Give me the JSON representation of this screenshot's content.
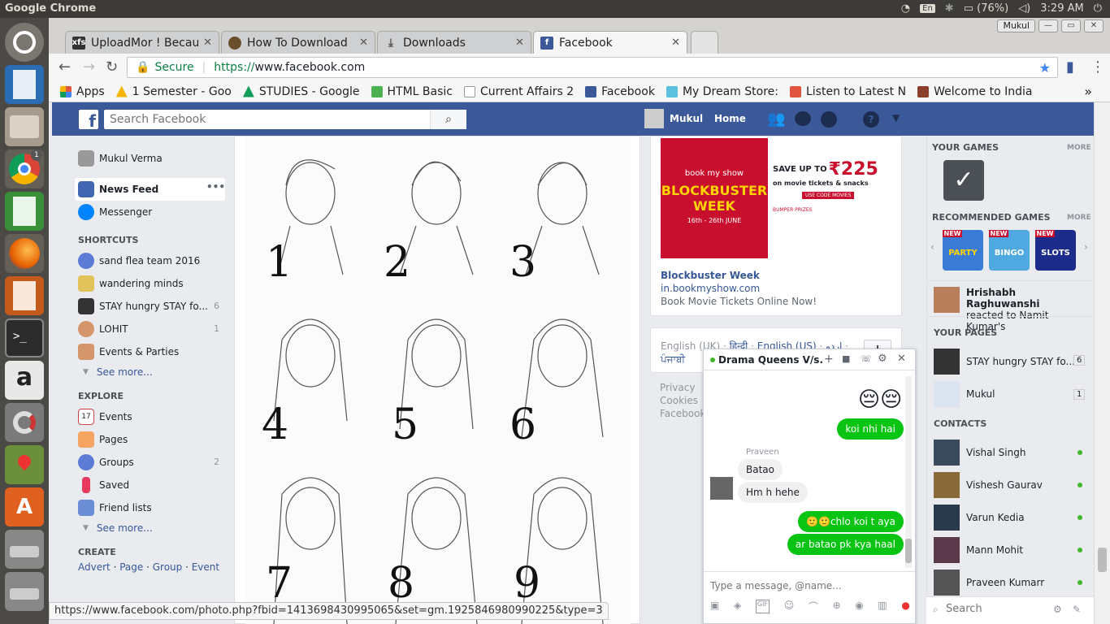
{
  "os": {
    "app_title": "Google Chrome",
    "keyboard": "En",
    "battery": "(76%)",
    "time": "3:29 AM",
    "launcher_icons": [
      "ubuntu-dash",
      "document-viewer",
      "files",
      "chrome",
      "spreadsheet",
      "firefox",
      "presentation",
      "terminal",
      "amazon",
      "system-settings",
      "maps",
      "software-center",
      "drive-1",
      "drive-2"
    ],
    "chrome_badge": "1"
  },
  "browser": {
    "profile": "Mukul",
    "tabs": [
      {
        "label": "UploadMor ! Becau",
        "favicon": "xfs",
        "fav_color": "#333333"
      },
      {
        "label": "How To Download",
        "favicon": "hat",
        "fav_color": "#6b4f2a"
      },
      {
        "label": "Downloads",
        "favicon": "download-icon",
        "fav_color": "#555555"
      },
      {
        "label": "Facebook",
        "favicon": "f",
        "fav_color": "#3b5998"
      }
    ],
    "secure_label": "Secure",
    "url_scheme": "https://",
    "url_host": "www.facebook.com",
    "bookmarks": [
      {
        "label": "Apps",
        "icon": "apps-icon",
        "color": "#e1543f"
      },
      {
        "label": "1 Semester - Goo",
        "icon": "drive-icon",
        "color": "#f4b400"
      },
      {
        "label": "STUDIES - Google",
        "icon": "drive-icon",
        "color": "#0f9d58"
      },
      {
        "label": "HTML Basic",
        "icon": "w3-icon",
        "color": "#4caf50"
      },
      {
        "label": "Current Affairs 2",
        "icon": "page-icon",
        "color": "#bbbbbb"
      },
      {
        "label": "Facebook",
        "icon": "facebook-icon",
        "color": "#3b5998"
      },
      {
        "label": "My Dream Store:",
        "icon": "store-icon",
        "color": "#5bc0de"
      },
      {
        "label": "Listen to Latest N",
        "icon": "gaana-icon",
        "color": "#e1543f"
      },
      {
        "label": "Welcome to India",
        "icon": "india-icon",
        "color": "#8a3f2b"
      }
    ],
    "status_url": "https://www.facebook.com/photo.php?fbid=1413698430995065&set=gm.1925846980990225&type=3"
  },
  "facebook": {
    "search_placeholder": "Search Facebook",
    "user_name": "Mukul",
    "home_label": "Home",
    "left_nav": {
      "profile": "Mukul Verma",
      "news_feed": "News Feed",
      "messenger": "Messenger",
      "shortcuts_header": "SHORTCUTS",
      "shortcuts": [
        {
          "label": "sand flea team 2016",
          "count": ""
        },
        {
          "label": "wandering minds",
          "count": ""
        },
        {
          "label": "STAY hungry STAY fo...",
          "count": "6"
        },
        {
          "label": "LOHIT",
          "count": "1"
        },
        {
          "label": "Events & Parties",
          "count": ""
        }
      ],
      "see_more_1": "See more...",
      "explore_header": "EXPLORE",
      "explore": [
        {
          "label": "Events",
          "count": ""
        },
        {
          "label": "Pages",
          "count": ""
        },
        {
          "label": "Groups",
          "count": "2"
        },
        {
          "label": "Saved",
          "count": ""
        },
        {
          "label": "Friend lists",
          "count": ""
        }
      ],
      "see_more_2": "See more...",
      "create_header": "CREATE",
      "create_links": [
        "Advert",
        "Page",
        "Group",
        "Event"
      ]
    },
    "post_image": {
      "numbers": [
        "1",
        "2",
        "3",
        "4",
        "5",
        "6",
        "7",
        "8",
        "9"
      ]
    },
    "ad": {
      "brand": "book my show",
      "headline_1": "BLOCKBUSTER",
      "headline_2": "WEEK",
      "dates": "16th - 26th JUNE",
      "save_upto": "SAVE UP TO",
      "amount": "₹225",
      "on_tickets": "on movie tickets",
      "snacks": "snacks",
      "code": "USE CODE MOVIES",
      "bumper": "BUMPER PRIZES",
      "title": "Blockbuster Week",
      "domain": "in.bookmyshow.com",
      "desc": "Book Movie Tickets Online Now!"
    },
    "languages": {
      "current": "English (UK)",
      "others": [
        "हिन्दी",
        "English (US)",
        "اردو",
        "ਪੰਜਾਬੀ"
      ],
      "add": "+"
    },
    "footer_links": [
      "Privacy",
      "Cookies",
      "Facebook"
    ],
    "right_col": {
      "your_games": "YOUR GAMES",
      "more": "MORE",
      "recommended_games": "RECOMMENDED GAMES",
      "games": [
        {
          "label": "PARTY",
          "badge": "NEW",
          "color": "#3a7bd5"
        },
        {
          "label": "BINGO",
          "badge": "NEW",
          "color": "#4fa8e0"
        },
        {
          "label": "SLOTS",
          "badge": "NEW",
          "color": "#1d2b8a"
        }
      ],
      "ticker_name": "Hrishabh Raghuwanshi",
      "ticker_text": "reacted to Namit Kumar's",
      "your_pages": "YOUR PAGES",
      "pages": [
        {
          "label": "STAY hungry STAY fo...",
          "count": "6"
        },
        {
          "label": "Mukul",
          "count": "1"
        }
      ],
      "contacts_header": "CONTACTS",
      "contacts": [
        "Vishal Singh",
        "Vishesh Gaurav",
        "Varun Kedia",
        "Mann Mohit",
        "Praveen Kumarr"
      ],
      "search_placeholder": "Search"
    },
    "chat": {
      "title": "Drama Queens V/s...",
      "messages": [
        {
          "from": "me",
          "text": "koi nhi hai"
        },
        {
          "from": "them",
          "sender": "Praveen",
          "text": "Batao"
        },
        {
          "from": "them",
          "text": "Hm h hehe"
        },
        {
          "from": "me",
          "text": "🙂🙂chlo koi t aya"
        },
        {
          "from": "me",
          "text": "ar batao pk kya haal"
        }
      ],
      "input_placeholder": "Type a message, @name..."
    }
  }
}
